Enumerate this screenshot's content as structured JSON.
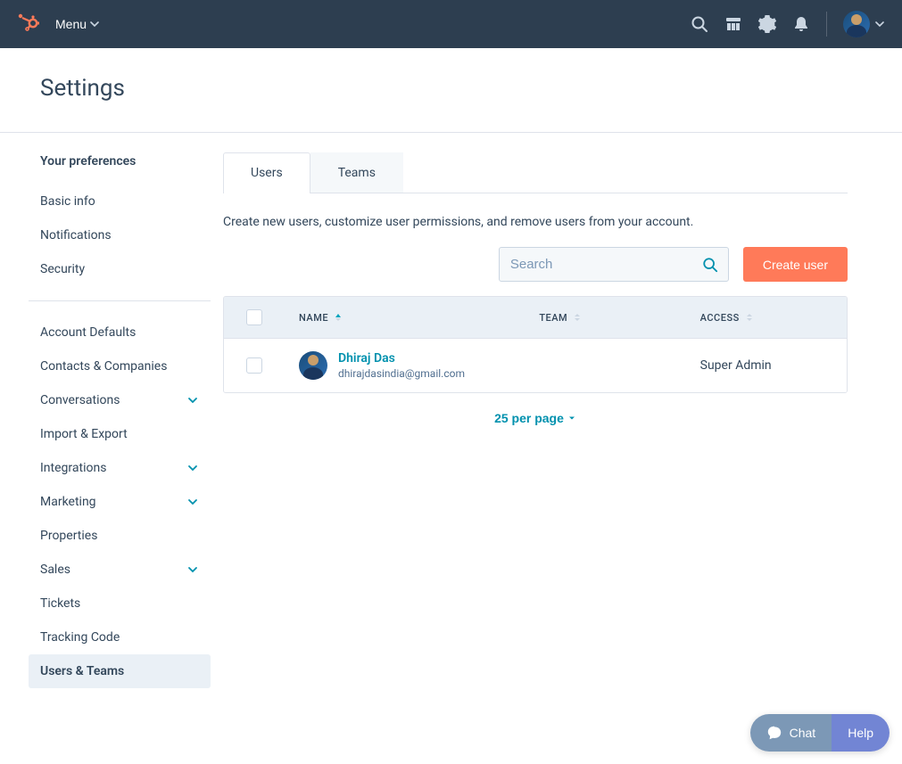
{
  "topnav": {
    "menu_label": "Menu"
  },
  "page": {
    "title": "Settings"
  },
  "sidebar": {
    "section_heading": "Your preferences",
    "top_items": [
      {
        "label": "Basic info",
        "expandable": false
      },
      {
        "label": "Notifications",
        "expandable": false
      },
      {
        "label": "Security",
        "expandable": false
      }
    ],
    "bottom_items": [
      {
        "label": "Account Defaults",
        "expandable": false
      },
      {
        "label": "Contacts & Companies",
        "expandable": false
      },
      {
        "label": "Conversations",
        "expandable": true
      },
      {
        "label": "Import & Export",
        "expandable": false
      },
      {
        "label": "Integrations",
        "expandable": true
      },
      {
        "label": "Marketing",
        "expandable": true
      },
      {
        "label": "Properties",
        "expandable": false
      },
      {
        "label": "Sales",
        "expandable": true
      },
      {
        "label": "Tickets",
        "expandable": false
      },
      {
        "label": "Tracking Code",
        "expandable": false
      },
      {
        "label": "Users & Teams",
        "expandable": false,
        "active": true
      }
    ]
  },
  "tabs": [
    {
      "label": "Users",
      "active": true
    },
    {
      "label": "Teams",
      "active": false
    }
  ],
  "main": {
    "description": "Create new users, customize user permissions, and remove users from your account.",
    "search_placeholder": "Search",
    "create_button": "Create user",
    "columns": {
      "name": "NAME",
      "team": "TEAM",
      "access": "ACCESS"
    },
    "rows": [
      {
        "name": "Dhiraj Das",
        "email": "dhirajdasindia@gmail.com",
        "team": "",
        "access": "Super Admin"
      }
    ],
    "pager_label": "25 per page"
  },
  "widgets": {
    "chat": "Chat",
    "help": "Help"
  },
  "colors": {
    "accent_orange": "#ff7a59",
    "accent_teal": "#0091ae",
    "topnav_bg": "#2d3e50"
  }
}
